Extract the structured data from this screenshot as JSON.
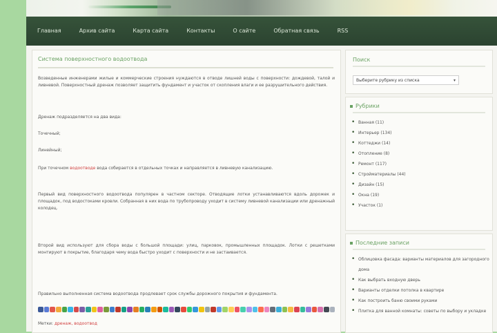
{
  "nav": {
    "items": [
      "Главная",
      "Архив сайта",
      "Карта сайта",
      "Контакты",
      "О сайте",
      "Обратная связь",
      "RSS"
    ]
  },
  "post": {
    "title": "Система поверхностного водоотвода",
    "paragraphs": [
      "Возведенные инженерами жилые и коммерческие строения нуждаются в отводе лишней воды с поверхности: дождевой, талой и ливневой. Поверхностный дренаж позволяет защитить фундамент и участок от скопления влаги и ее разрушительного действия.",
      "Дренаж подразделяется на два вида:",
      "Точечный;",
      "Линейный;",
      "При точечном водоотводе вода собирается в отдельных точках и направляется в ливневую канализацию.",
      "Первый вид поверхностного водоотвода популярен в частном секторе. Отводящие лотки устанавливаются вдоль дорожек и площадок, под водостоками кровли. Собранная в них вода по трубопроводу уходит в систему ливневой канализации или дренажный колодец.",
      "Второй вид используют для сбора воды с большой площади: улиц, парковок, промышленных площадок. Лотки с решетками монтируют в покрытие, благодаря чему вода быстро уходит с поверхности и не застаивается.",
      "Правильно выполненная система водоотвода продлевает срок службы дорожного покрытия и фундамента."
    ],
    "link_word": "водоотводе",
    "tags_label": "Метки:",
    "tags_text": "дренаж, водоотвод",
    "share_colors": [
      "#3b5998",
      "#5b7bd5",
      "#e2574c",
      "#f2a93b",
      "#47a447",
      "#37b4e6",
      "#d64b4b",
      "#7b5ea7",
      "#2aa198",
      "#f0c419",
      "#e05f9e",
      "#7a9a3a",
      "#3d7dca",
      "#c0392b",
      "#16a085",
      "#8e44ad",
      "#e67e22",
      "#27ae60",
      "#2980b9",
      "#f39c12",
      "#d35400",
      "#1abc9c",
      "#9b59b6",
      "#34495e",
      "#e74c3c",
      "#2ecc71",
      "#3498db",
      "#f1c40f",
      "#95a5a6",
      "#c0392b",
      "#5d9cec",
      "#a0d468",
      "#ffce54",
      "#ed5565",
      "#48cfad",
      "#ac92ec",
      "#4fc1e9",
      "#fc6e51",
      "#ec87c0",
      "#656d78",
      "#3bafda",
      "#8cc152",
      "#f6bb42",
      "#da4453",
      "#37bc9b",
      "#967adc",
      "#e9573f",
      "#d770ad",
      "#434a54",
      "#aab2bd"
    ]
  },
  "sidebar": {
    "search_title": "Поиск",
    "select_value": "Выберите рубрику из списка",
    "rubrics_title": "Рубрики",
    "rubrics": [
      "Ванная (11)",
      "Интерьер (134)",
      "Коттеджи (14)",
      "Отопление (8)",
      "Ремонт (117)",
      "Стройматериалы (44)",
      "Дизайн (15)",
      "Окна (19)",
      "Участок (1)"
    ],
    "recent_title": "Последние записи",
    "recent": [
      "Облицовка фасада: варианты материалов для загородного дома",
      "Как выбрать входную дверь",
      "Варианты отделки потолка в квартире",
      "Как построить баню своими руками",
      "Плитка для ванной комнаты: советы по выбору и укладке"
    ]
  }
}
